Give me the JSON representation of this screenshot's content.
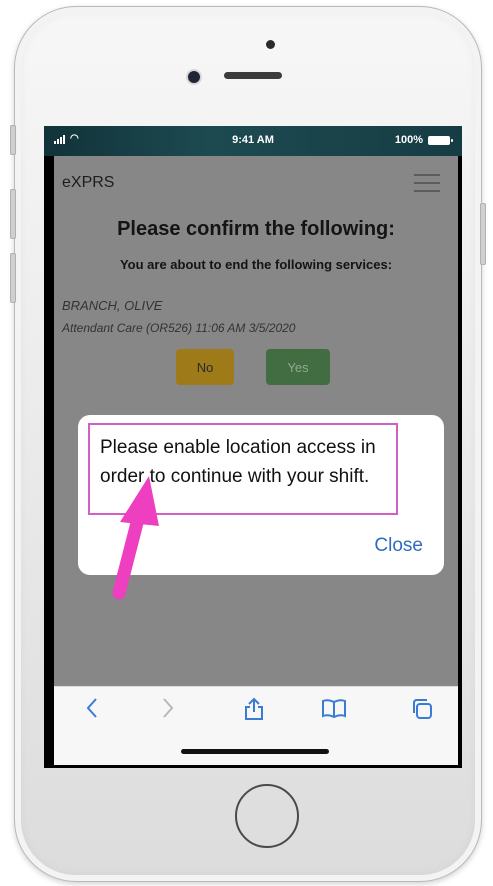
{
  "status_bar": {
    "time": "9:41 AM",
    "battery": "100%"
  },
  "app": {
    "title": "eXPRS",
    "heading": "Please confirm the following:",
    "subheading": "You are about to end the following services:",
    "client_name": "BRANCH, OLIVE",
    "service_line": "Attendant Care (OR526) 11:06 AM 3/5/2020",
    "no_label": "No",
    "yes_label": "Yes"
  },
  "dialog": {
    "message": "Please enable location access in order to continue with your shift.",
    "close_label": "Close"
  },
  "toolbar": {
    "back_icon": "chevron-left-icon",
    "forward_icon": "chevron-right-icon",
    "share_icon": "share-icon",
    "bookmarks_icon": "book-icon",
    "tabs_icon": "tabs-icon"
  },
  "colors": {
    "overlay": "#878787",
    "no_button": "#9e7a19",
    "yes_button": "#426d43",
    "highlight": "#d25fc5",
    "pointer_arrow": "#ee3fc0",
    "link": "#2f6cc1"
  }
}
